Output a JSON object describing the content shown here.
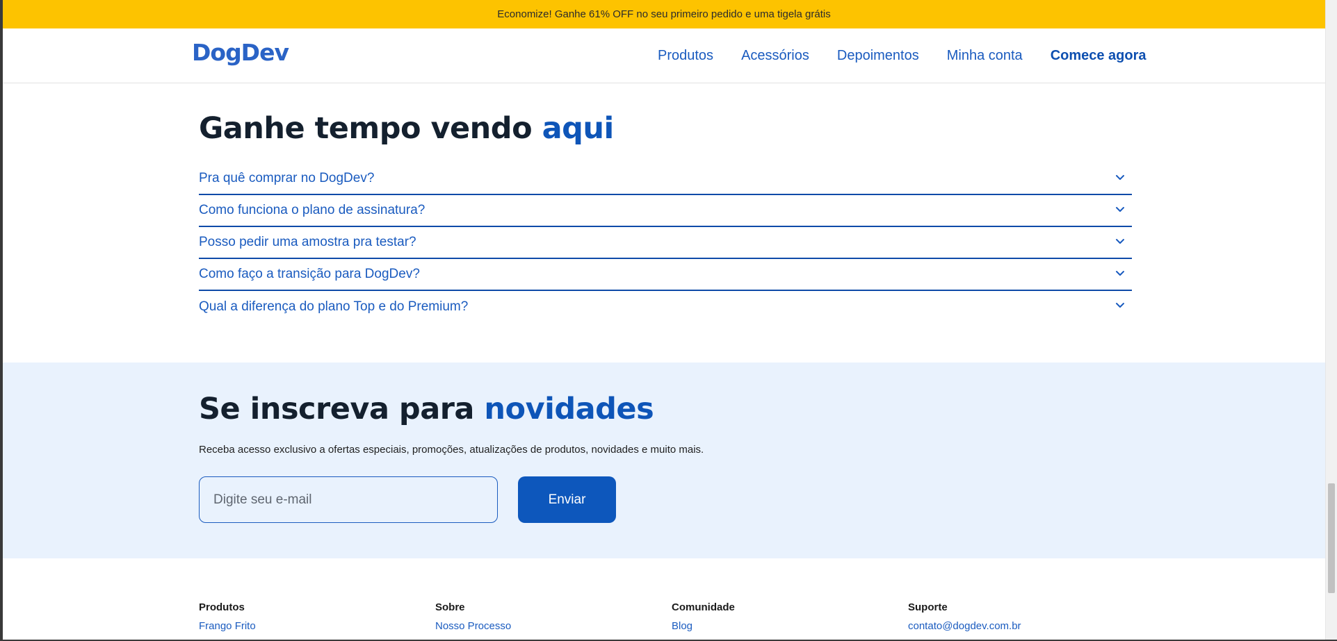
{
  "promo": {
    "text": "Economize! Ganhe 61% OFF no seu primeiro pedido e uma tigela grátis"
  },
  "header": {
    "logo": "DogDev",
    "nav": [
      {
        "label": "Produtos"
      },
      {
        "label": "Acessórios"
      },
      {
        "label": "Depoimentos"
      },
      {
        "label": "Minha conta"
      },
      {
        "label": "Comece agora"
      }
    ]
  },
  "faq": {
    "title_main": "Ganhe tempo vendo ",
    "title_accent": "aqui",
    "items": [
      {
        "question": "Pra quê comprar no DogDev?"
      },
      {
        "question": "Como funciona o plano de assinatura?"
      },
      {
        "question": "Posso pedir uma amostra pra testar?"
      },
      {
        "question": "Como faço a transição para DogDev?"
      },
      {
        "question": "Qual a diferença do plano Top e do Premium?"
      }
    ]
  },
  "subscribe": {
    "title_main": "Se inscreva para ",
    "title_accent": "novidades",
    "description": "Receba acesso exclusivo a ofertas especiais, promoções, atualizações de produtos, novidades e muito mais.",
    "email_placeholder": "Digite seu e-mail",
    "email_value": "",
    "button_label": "Enviar"
  },
  "footer": {
    "columns": [
      {
        "heading": "Produtos",
        "link": "Frango Frito"
      },
      {
        "heading": "Sobre",
        "link": "Nosso Processo"
      },
      {
        "heading": "Comunidade",
        "link": "Blog"
      },
      {
        "heading": "Suporte",
        "link": "contato@dogdev.com.br"
      }
    ]
  },
  "colors": {
    "promo_bg": "#fdc300",
    "brand_blue": "#0d57bc",
    "subscribe_bg": "#e9f2fd"
  },
  "icons": {
    "faq_toggle": "chevron-down-icon"
  }
}
